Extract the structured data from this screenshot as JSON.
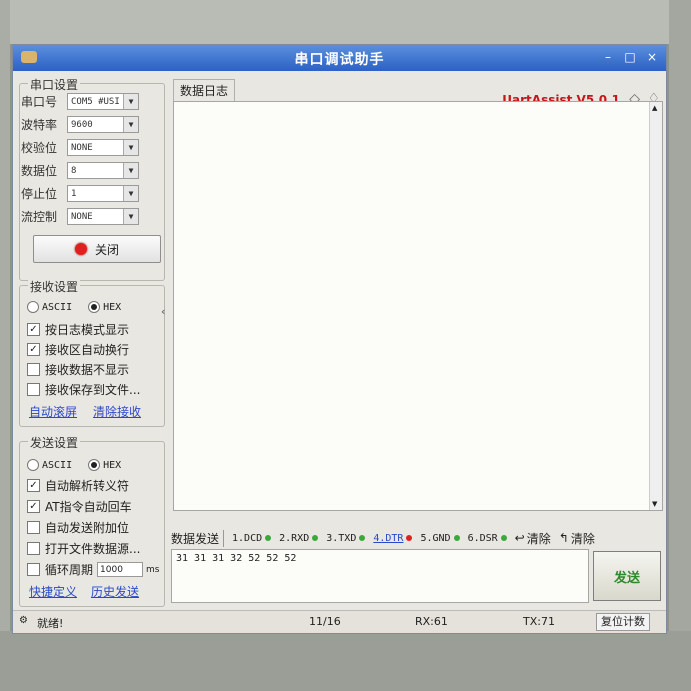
{
  "window": {
    "title": "串口调试助手"
  },
  "brand": "UartAssist V5.0.1",
  "serial_settings": {
    "group_title": "串口设置",
    "rows": [
      {
        "label": "串口号",
        "value": "COM5 #USI"
      },
      {
        "label": "波特率",
        "value": "9600"
      },
      {
        "label": "校验位",
        "value": "NONE"
      },
      {
        "label": "数据位",
        "value": "8"
      },
      {
        "label": "停止位",
        "value": "1"
      },
      {
        "label": "流控制",
        "value": "NONE"
      }
    ],
    "close_button": "关闭"
  },
  "receive_settings": {
    "group_title": "接收设置",
    "mode_ascii": "ASCII",
    "mode_hex": "HEX",
    "options": [
      {
        "label": "按日志模式显示",
        "checked": true
      },
      {
        "label": "接收区自动换行",
        "checked": true
      },
      {
        "label": "接收数据不显示",
        "checked": false
      },
      {
        "label": "接收保存到文件...",
        "checked": false
      }
    ],
    "auto_scroll": "自动滚屏",
    "clear_receive": "清除接收"
  },
  "send_settings": {
    "group_title": "发送设置",
    "mode_ascii": "ASCII",
    "mode_hex": "HEX",
    "options": [
      {
        "label": "自动解析转义符",
        "checked": true
      },
      {
        "label": "AT指令自动回车",
        "checked": true
      },
      {
        "label": "自动发送附加位",
        "checked": false
      },
      {
        "label": "打开文件数据源...",
        "checked": false
      },
      {
        "label": "循环周期",
        "checked": false
      }
    ],
    "period_value": "1000",
    "period_unit": "ms",
    "quick_define": "快捷定义",
    "history_send": "历史发送"
  },
  "log_tab": "数据日志",
  "send_tab": "数据发送",
  "signals": [
    {
      "label": "1.DCD",
      "color": "#3aa83a",
      "active": false
    },
    {
      "label": "2.RXD",
      "color": "#3aa83a",
      "active": false
    },
    {
      "label": "3.TXD",
      "color": "#3aa83a",
      "active": false
    },
    {
      "label": "4.DTR",
      "color": "#e02020",
      "active": true
    },
    {
      "label": "5.GND",
      "color": "#3aa83a",
      "active": false
    },
    {
      "label": "6.DSR",
      "color": "#3aa83a",
      "active": false
    }
  ],
  "clear_label": "清除",
  "clear2_label": "清除",
  "send_content": "31 31 31 32 52 52 52",
  "send_button": "发送",
  "status": {
    "ready": "就绪!",
    "count": "11/16",
    "rx": "RX:61",
    "tx": "TX:71",
    "reset": "复位计数"
  }
}
